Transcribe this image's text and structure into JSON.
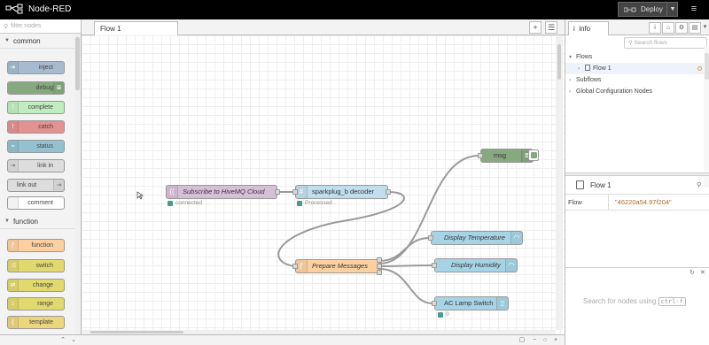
{
  "app": {
    "title": "Node-RED",
    "deploy_label": "Deploy"
  },
  "palette": {
    "filter_placeholder": "filter nodes",
    "categories": [
      {
        "label": "common",
        "nodes": [
          "inject",
          "debug",
          "complete",
          "catch",
          "status",
          "link in",
          "link out",
          "comment"
        ]
      },
      {
        "label": "function",
        "nodes": [
          "function",
          "switch",
          "change",
          "range",
          "template"
        ]
      }
    ]
  },
  "workspace": {
    "tab_label": "Flow 1"
  },
  "flow": {
    "nodes": {
      "subscribe": {
        "label": "Subscribe to HiveMQ Cloud",
        "status": "connected"
      },
      "decoder": {
        "label": "sparkplug_b decoder",
        "status": "Processed"
      },
      "msg": {
        "label": "msg"
      },
      "prepare": {
        "label": "Prepare Messages"
      },
      "temp": {
        "label": "Display Temperature"
      },
      "humidity": {
        "label": "Display Humidity"
      },
      "lamp": {
        "label": "AC Lamp Switch",
        "status": "0"
      }
    }
  },
  "sidebar": {
    "tab_label": "info",
    "search_placeholder": "Search flows",
    "tree": {
      "flows": "Flows",
      "flow1": "Flow 1",
      "subflows": "Subflows",
      "global": "Global Configuration Nodes"
    },
    "props_title": "Flow 1",
    "prop_key": "Flow",
    "prop_value": "\"46220a54.97f204\"",
    "help_hint": "Search for nodes using",
    "help_key": "ctrl-f"
  },
  "colors": {
    "inject": "#a6bbcf",
    "debug": "#87a980",
    "complete": "#c0edc0",
    "catch": "#e49191",
    "status": "#94c1d0",
    "link": "#dddddd",
    "comment": "#ffffff",
    "function": "#fdd0a2",
    "switch": "#e2d96e",
    "change": "#e2d96e",
    "range": "#e2d96e",
    "template": "#ebd67e",
    "mqtt": "#d8bfd8",
    "decoder": "#c0deed",
    "dashboard": "#a6d4e6"
  }
}
